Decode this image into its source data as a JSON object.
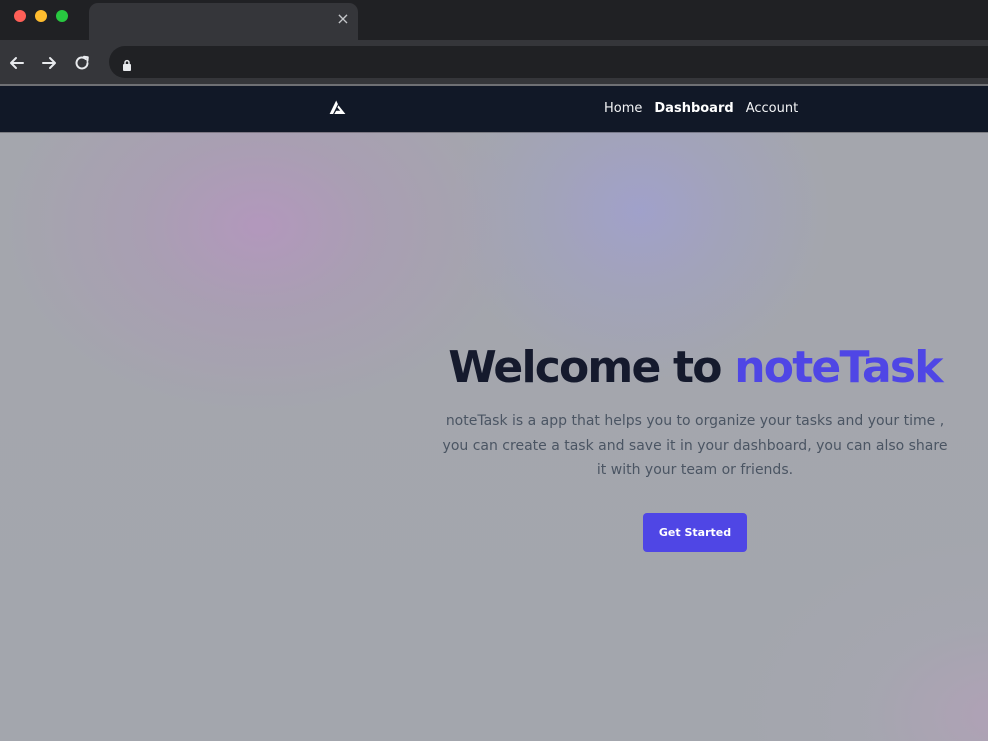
{
  "browser": {
    "tab_close_glyph": "×"
  },
  "site_nav": {
    "links": [
      {
        "label": "Home",
        "active": false
      },
      {
        "label": "Dashboard",
        "active": true
      },
      {
        "label": "Account",
        "active": false
      }
    ]
  },
  "hero": {
    "title_prefix": "Welcome to",
    "title_accent": "noteTask",
    "description": "noteTask is a app that helps you to organize your tasks and your time , you can create a task and save it in your dashboard, you can also share it with your team or friends.",
    "cta_label": "Get Started"
  },
  "icons": {
    "browser": [
      "close-icon",
      "back-arrow-icon",
      "forward-arrow-icon",
      "reload-icon",
      "lock-icon"
    ],
    "site": [
      "logo-icon"
    ]
  },
  "colors": {
    "browser_bg": "#202124",
    "toolbar_bg": "#35363a",
    "navbar_bg": "#111827",
    "title_dark": "#151a2d",
    "accent": "#4f46e5",
    "body_text": "#4b5563",
    "page_bg": "#a2a5ad"
  }
}
